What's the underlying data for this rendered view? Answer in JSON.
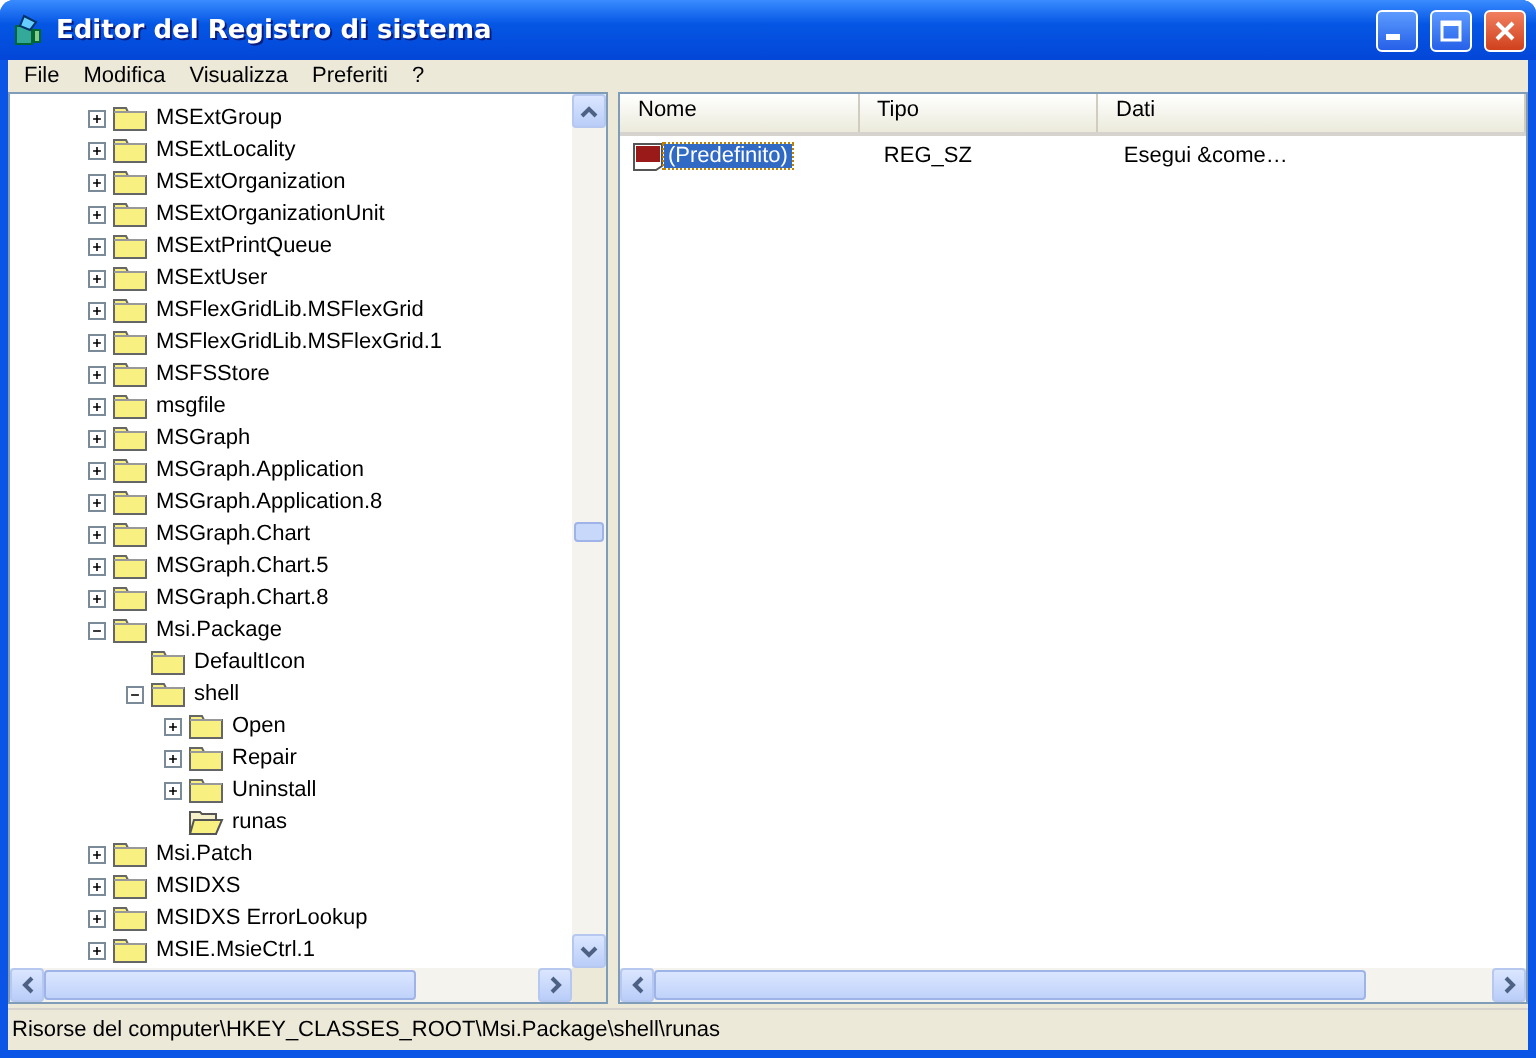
{
  "window": {
    "title": "Editor del Registro di sistema"
  },
  "menu": [
    "File",
    "Modifica",
    "Visualizza",
    "Preferiti",
    "?"
  ],
  "tree": [
    {
      "label": "MSExtGroup",
      "kind": "collapsed",
      "selected": false
    },
    {
      "label": "MSExtLocality",
      "kind": "collapsed",
      "selected": false
    },
    {
      "label": "MSExtOrganization",
      "kind": "collapsed",
      "selected": false
    },
    {
      "label": "MSExtOrganizationUnit",
      "kind": "collapsed",
      "selected": false
    },
    {
      "label": "MSExtPrintQueue",
      "kind": "collapsed",
      "selected": false
    },
    {
      "label": "MSExtUser",
      "kind": "collapsed",
      "selected": false
    },
    {
      "label": "MSFlexGridLib.MSFlexGrid",
      "kind": "collapsed",
      "selected": false
    },
    {
      "label": "MSFlexGridLib.MSFlexGrid.1",
      "kind": "collapsed",
      "selected": false
    },
    {
      "label": "MSFSStore",
      "kind": "collapsed",
      "selected": false
    },
    {
      "label": "msgfile",
      "kind": "collapsed",
      "selected": false
    },
    {
      "label": "MSGraph",
      "kind": "collapsed",
      "selected": false
    },
    {
      "label": "MSGraph.Application",
      "kind": "collapsed",
      "selected": false
    },
    {
      "label": "MSGraph.Application.8",
      "kind": "collapsed",
      "selected": false
    },
    {
      "label": "MSGraph.Chart",
      "kind": "collapsed",
      "selected": false
    },
    {
      "label": "MSGraph.Chart.5",
      "kind": "collapsed",
      "selected": false
    },
    {
      "label": "MSGraph.Chart.8",
      "kind": "collapsed",
      "selected": false
    },
    {
      "label": "Msi.Package",
      "kind": "expanded",
      "selected": false,
      "children": [
        {
          "label": "DefaultIcon",
          "kind": "leaf",
          "selected": false
        },
        {
          "label": "shell",
          "kind": "expanded",
          "selected": false,
          "children": [
            {
              "label": "Open",
              "kind": "collapsed",
              "selected": false
            },
            {
              "label": "Repair",
              "kind": "collapsed",
              "selected": false
            },
            {
              "label": "Uninstall",
              "kind": "collapsed",
              "selected": false
            },
            {
              "label": "runas",
              "kind": "leaf",
              "selected": true
            }
          ]
        }
      ]
    },
    {
      "label": "Msi.Patch",
      "kind": "collapsed",
      "selected": false
    },
    {
      "label": "MSIDXS",
      "kind": "collapsed",
      "selected": false
    },
    {
      "label": "MSIDXS ErrorLookup",
      "kind": "collapsed",
      "selected": false
    },
    {
      "label": "MSIE.MsieCtrl.1",
      "kind": "collapsed",
      "selected": false
    }
  ],
  "values": {
    "columns": [
      "Nome",
      "Tipo",
      "Dati"
    ],
    "rows": [
      {
        "name": "(Predefinito)",
        "type": "REG_SZ",
        "data": "Esegui &come…",
        "selected": true
      }
    ]
  },
  "status_bar": "Risorse del computer\\HKEY_CLASSES_ROOT\\Msi.Package\\shell\\runas"
}
